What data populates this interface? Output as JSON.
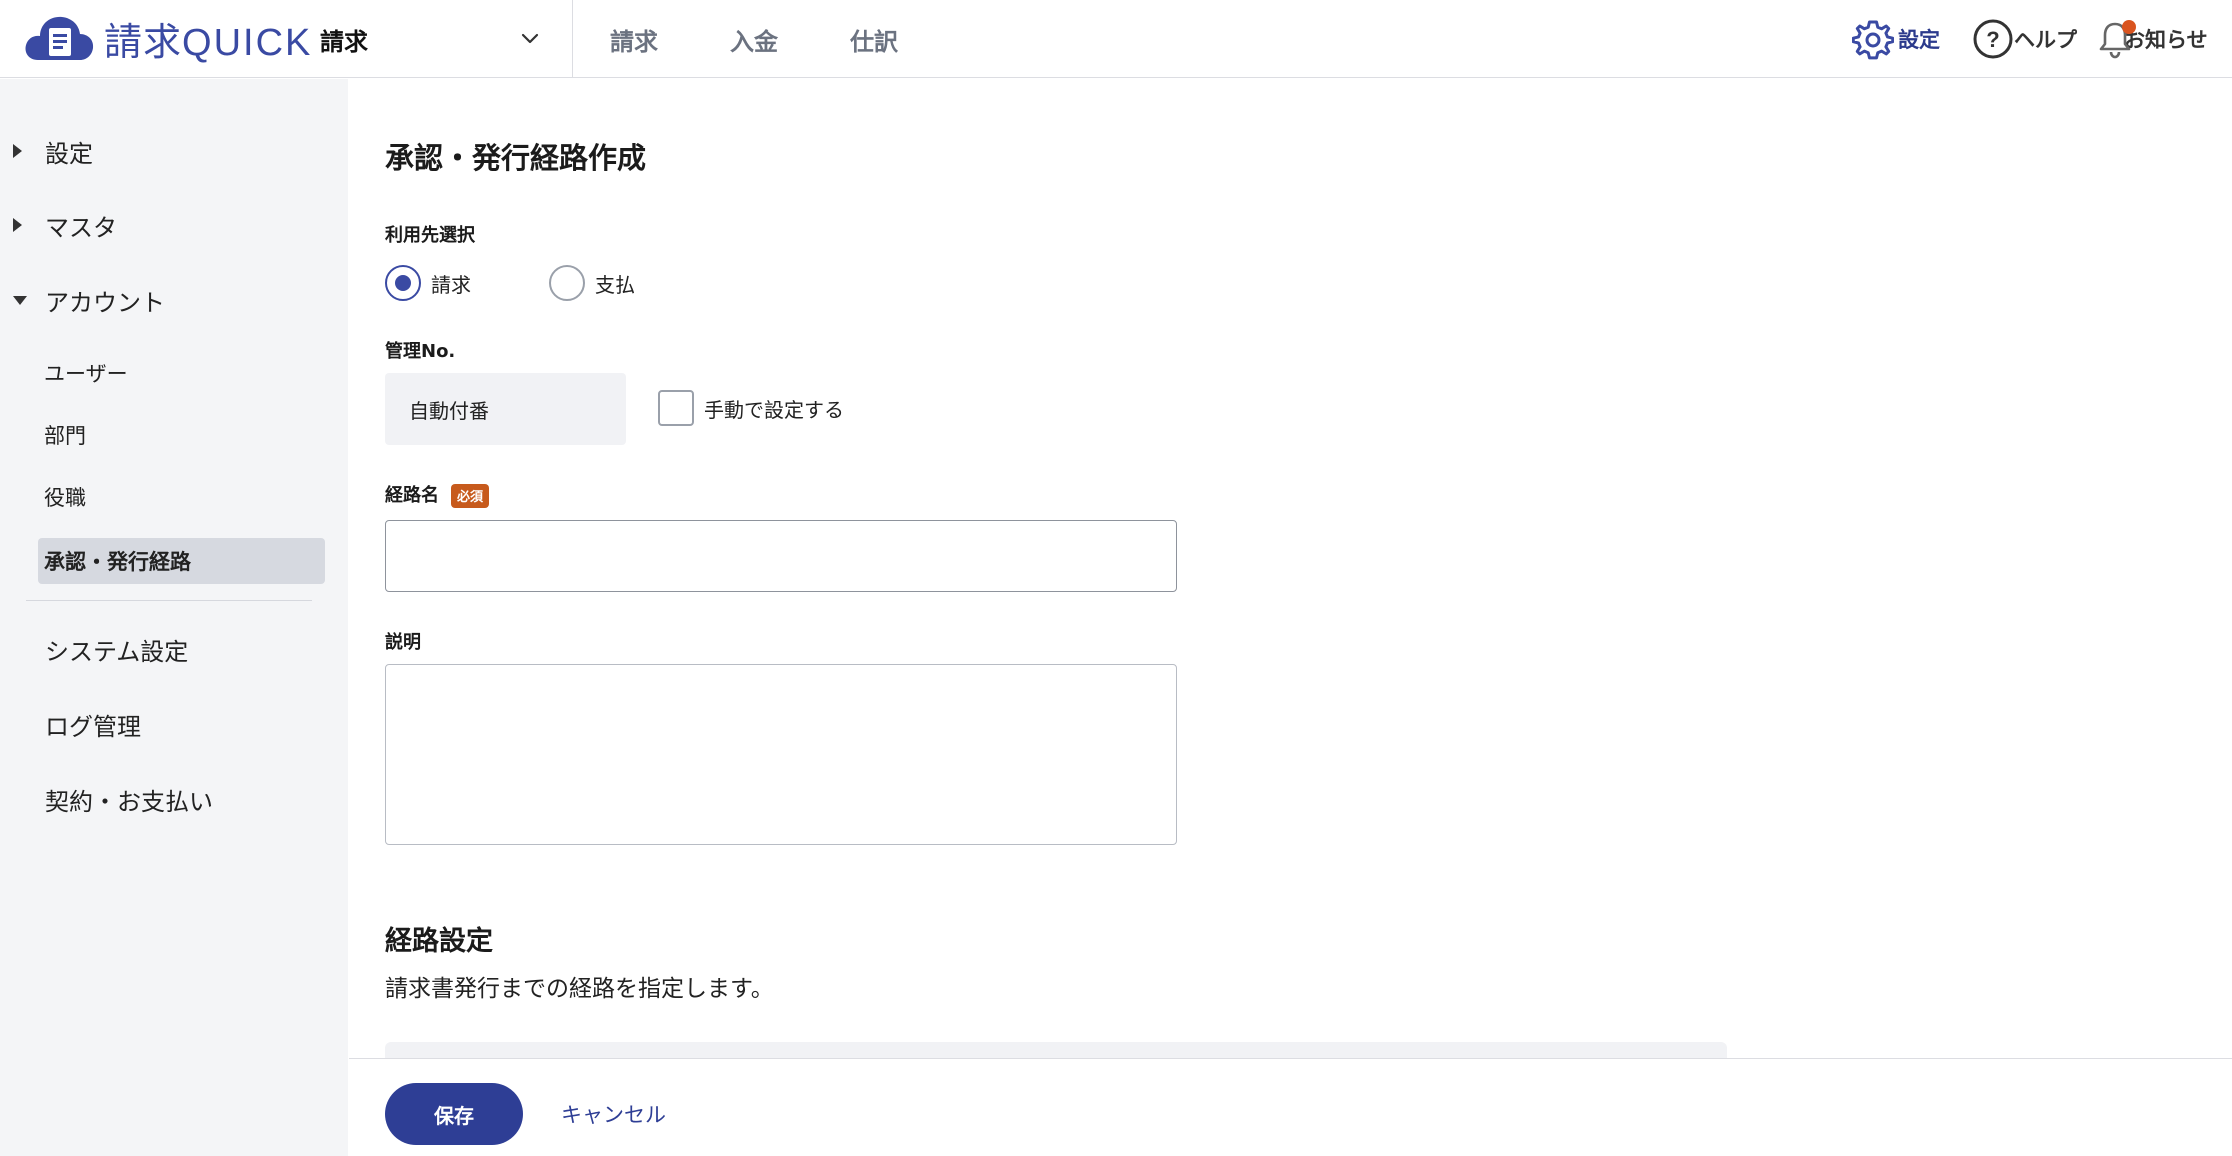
{
  "header": {
    "logo": {
      "kanji": "請求",
      "latin": "QUICK"
    },
    "app_select": {
      "label": "請求"
    },
    "nav": [
      {
        "label": "請求"
      },
      {
        "label": "入金"
      },
      {
        "label": "仕訳"
      }
    ],
    "settings_label": "設定",
    "help_label": "ヘルプ",
    "notifications_label": "お知らせ",
    "accent_color": "#3a4aa3",
    "notification_dot_color": "#d9541f"
  },
  "sidebar": {
    "groups": [
      {
        "label": "設定",
        "expanded": false
      },
      {
        "label": "マスタ",
        "expanded": false
      },
      {
        "label": "アカウント",
        "expanded": true
      }
    ],
    "account_items": [
      {
        "label": "ユーザー"
      },
      {
        "label": "部門"
      },
      {
        "label": "役職"
      },
      {
        "label": "承認・発行経路",
        "active": true
      }
    ],
    "other_items": [
      {
        "label": "システム設定"
      },
      {
        "label": "ログ管理"
      },
      {
        "label": "契約・お支払い"
      }
    ]
  },
  "main": {
    "title": "承認・発行経路作成",
    "usage": {
      "label": "利用先選択",
      "options": [
        {
          "label": "請求",
          "checked": true
        },
        {
          "label": "支払",
          "checked": false
        }
      ]
    },
    "management_no": {
      "label": "管理No.",
      "value": "自動付番",
      "manual_checkbox_label": "手動で設定する",
      "manual_checked": false
    },
    "route_name": {
      "label": "経路名",
      "required_badge": "必須",
      "value": ""
    },
    "description": {
      "label": "説明",
      "value": ""
    },
    "route_settings": {
      "title": "経路設定",
      "description": "請求書発行までの経路を指定します。"
    }
  },
  "footer": {
    "save_label": "保存",
    "cancel_label": "キャンセル",
    "save_color": "#2e3e95"
  }
}
